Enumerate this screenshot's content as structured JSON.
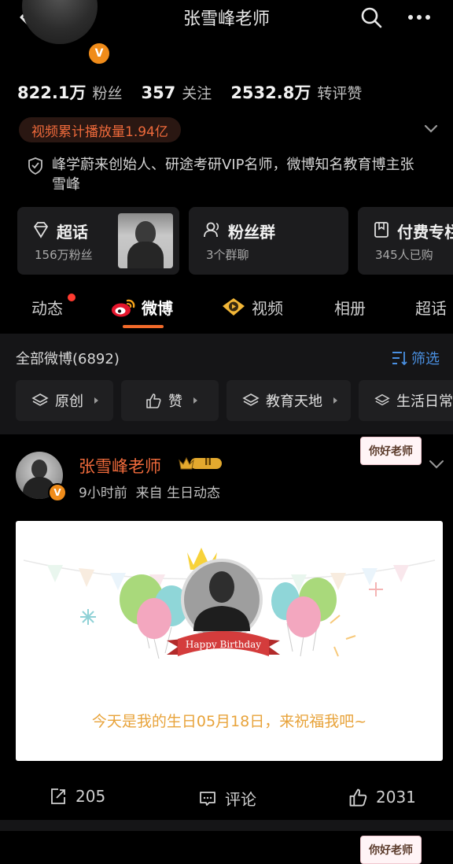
{
  "header": {
    "title": "张雪峰老师"
  },
  "profile": {
    "stats": [
      {
        "value": "822.1万",
        "label": "粉丝"
      },
      {
        "value": "357",
        "label": "关注"
      },
      {
        "value": "2532.8万",
        "label": "转评赞"
      }
    ],
    "play_count": "视频累计播放量1.94亿",
    "bio": "峰学蔚来创始人、研途考研VIP名师，微博知名教育博主张雪峰",
    "badge": "V"
  },
  "cards": [
    {
      "title": "超话",
      "sub": "156万粉丝"
    },
    {
      "title": "粉丝群",
      "sub": "3个群聊"
    },
    {
      "title": "付费专栏",
      "sub": "345人已购"
    }
  ],
  "tabs": [
    "动态",
    "微博",
    "视频",
    "相册",
    "超话"
  ],
  "filter": {
    "title": "全部微博(6892)",
    "filter_label": "筛选",
    "chips": [
      "原创",
      "赞",
      "教育天地",
      "生活日常"
    ]
  },
  "post": {
    "author": "张雪峰老师",
    "level": "II",
    "meta": "9小时前  来自 生日动态",
    "sticker": "你好老师",
    "birthday_banner": "Happy Birthday",
    "message": "今天是我的生日05月18日，来祝福我吧~",
    "actions": {
      "reposts": "205",
      "comments": "评论",
      "likes": "2031"
    }
  },
  "colors": {
    "accent": "#ef6a3b",
    "tab_underline": "#f26a2a",
    "link": "#4a90e2",
    "post_text": "#e8a33a"
  }
}
